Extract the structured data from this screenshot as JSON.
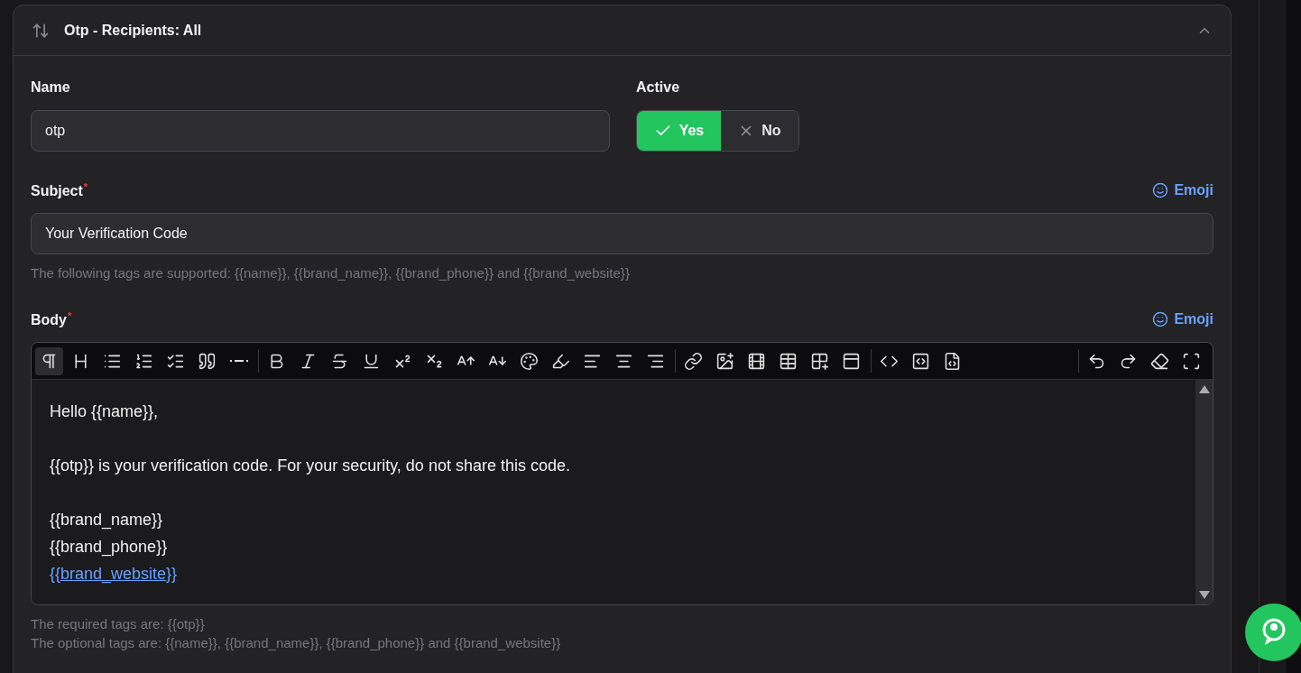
{
  "card": {
    "title": "Otp - Recipients: All",
    "expanded": true
  },
  "name_field": {
    "label": "Name",
    "value": "otp"
  },
  "active": {
    "label": "Active",
    "options": [
      {
        "label": "Yes",
        "kind": "yes",
        "selected": true
      },
      {
        "label": "No",
        "kind": "no",
        "selected": false
      }
    ]
  },
  "subject": {
    "label": "Subject",
    "required_mark": "*",
    "emoji_label": "Emoji",
    "value": "Your Verification Code",
    "hint": "The following tags are supported: {{name}}, {{brand_name}}, {{brand_phone}} and {{brand_website}}"
  },
  "body": {
    "label": "Body",
    "required_mark": "*",
    "emoji_label": "Emoji",
    "paragraph_selected": true,
    "paragraphs": [
      {
        "lines": [
          {
            "text": "Hello {{name}},",
            "link": false
          }
        ]
      },
      {
        "lines": [
          {
            "text": "{{otp}} is your verification code. For your security, do not share this code.",
            "link": false
          }
        ]
      },
      {
        "lines": [
          {
            "text": "{{brand_name}}",
            "link": false
          },
          {
            "text": "{{brand_phone}}",
            "link": false
          },
          {
            "text": "{{brand_website}}",
            "link": true
          }
        ]
      }
    ],
    "hints": [
      "The required tags are: {{otp}}",
      "The optional tags are: {{name}}, {{brand_name}}, {{brand_phone}} and {{brand_website}}"
    ]
  }
}
